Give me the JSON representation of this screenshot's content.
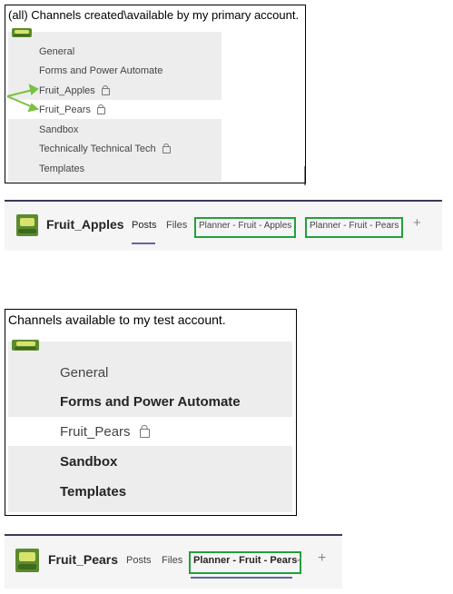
{
  "panel1": {
    "caption": "(all) Channels created\\available by my primary account.",
    "channels": [
      {
        "label": "General",
        "locked": false,
        "selected": false
      },
      {
        "label": "Forms and Power Automate",
        "locked": false,
        "selected": false
      },
      {
        "label": "Fruit_Apples",
        "locked": true,
        "selected": false
      },
      {
        "label": "Fruit_Pears",
        "locked": true,
        "selected": true
      },
      {
        "label": "Sandbox",
        "locked": false,
        "selected": false
      },
      {
        "label": "Technically Technical Tech",
        "locked": true,
        "selected": false
      },
      {
        "label": "Templates",
        "locked": false,
        "selected": false
      }
    ]
  },
  "header1": {
    "team_name": "Fruit_Apples",
    "tabs": [
      "Posts",
      "Files",
      "Planner - Fruit - Apples",
      "Planner - Fruit - Pears"
    ],
    "add_tab": "+"
  },
  "panel2": {
    "caption": "Channels available to my test account.",
    "channels": [
      {
        "label": "General",
        "bold": false,
        "locked": false,
        "selected": false
      },
      {
        "label": "Forms and Power Automate",
        "bold": true,
        "locked": false,
        "selected": false
      },
      {
        "label": "Fruit_Pears",
        "bold": false,
        "locked": true,
        "selected": true
      },
      {
        "label": "Sandbox",
        "bold": true,
        "locked": false,
        "selected": false
      },
      {
        "label": "Templates",
        "bold": true,
        "locked": false,
        "selected": false
      }
    ]
  },
  "header2": {
    "team_name": "Fruit_Pears",
    "tabs": [
      "Posts",
      "Files",
      "Planner - Fruit - Pears"
    ],
    "tab_check": "✓",
    "add_tab": "+"
  },
  "colors": {
    "highlight_box": "#20a139",
    "arrow": "#7ac143",
    "active_tab_underline": "#6264a7"
  }
}
